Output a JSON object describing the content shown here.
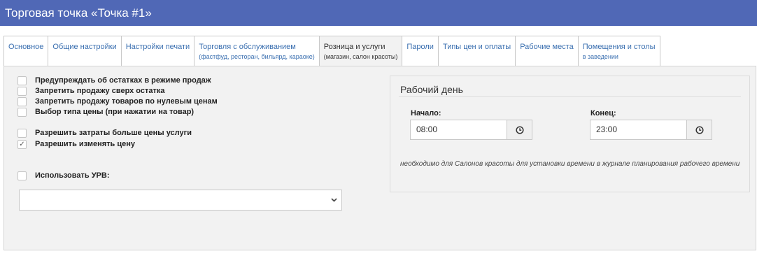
{
  "window": {
    "title": "Торговая точка «Точка #1»"
  },
  "tabs": [
    {
      "label": "Основное",
      "sub": ""
    },
    {
      "label": "Общие настройки",
      "sub": ""
    },
    {
      "label": "Настройки печати",
      "sub": ""
    },
    {
      "label": "Торговля с обслуживанием",
      "sub": "(фастфуд, ресторан, бильярд, караоке)"
    },
    {
      "label": "Розница и услуги",
      "sub": "(магазин, салон красоты)"
    },
    {
      "label": "Пароли",
      "sub": ""
    },
    {
      "label": "Типы цен и оплаты",
      "sub": ""
    },
    {
      "label": "Рабочие места",
      "sub": ""
    },
    {
      "label": "Помещения и столы",
      "sub": "в заведении"
    }
  ],
  "active_tab": "Розница и услуги",
  "options": [
    {
      "label": "Предупреждать об остатках в режиме продаж",
      "checked": false
    },
    {
      "label": "Запретить продажу сверх остатка",
      "checked": false
    },
    {
      "label": "Запретить продажу товаров по нулевым ценам",
      "checked": false
    },
    {
      "label": "Выбор типа цены (при нажатии на товар)",
      "checked": false
    },
    {
      "label": "Разрешить затраты больше цены услуги",
      "checked": false
    },
    {
      "label": "Разрешить изменять цену",
      "checked": true
    },
    {
      "label": "Использовать УРВ:",
      "checked": false
    }
  ],
  "urv_select": {
    "value": ""
  },
  "workday": {
    "title": "Рабочий день",
    "start_label": "Начало:",
    "start_value": "08:00",
    "end_label": "Конец:",
    "end_value": "23:00",
    "note": "необходимо для Салонов красоты для установки времени в журнале планирования рабочего времени"
  }
}
